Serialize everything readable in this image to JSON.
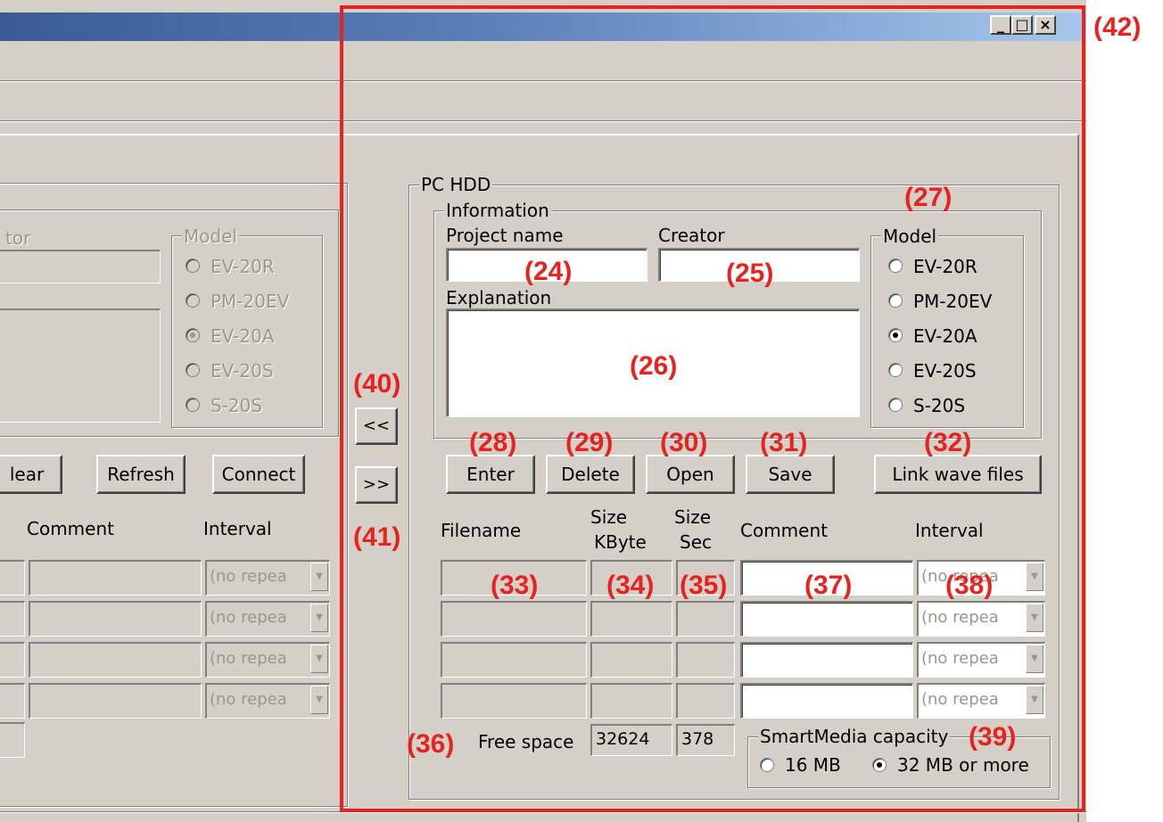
{
  "window_controls": {
    "minimize": "_",
    "maximize": "□",
    "close": "×"
  },
  "left_panel": {
    "creator_label_fragment": "tor",
    "model_legend": "Model",
    "models": [
      "EV-20R",
      "PM-20EV",
      "EV-20A",
      "EV-20S",
      "S-20S"
    ],
    "selected_model": "EV-20A",
    "buttons": {
      "clear": "lear",
      "refresh": "Refresh",
      "connect": "Connect"
    },
    "col_comment": "Comment",
    "col_interval": "Interval",
    "interval_value": "(no repea"
  },
  "transfer": {
    "copy_left": "<<",
    "copy_right": ">>"
  },
  "pc_hdd": {
    "legend": "PC HDD",
    "information_legend": "Information",
    "project_name_label": "Project name",
    "creator_label": "Creator",
    "explanation_label": "Explanation",
    "model_legend": "Model",
    "models": [
      "EV-20R",
      "PM-20EV",
      "EV-20A",
      "EV-20S",
      "S-20S"
    ],
    "selected_model": "EV-20A",
    "buttons": {
      "enter": "Enter",
      "delete": "Delete",
      "open": "Open",
      "save": "Save",
      "link": "Link wave files"
    },
    "columns": {
      "filename": "Filename",
      "size": "Size",
      "kbyte": "KByte",
      "size2": "Size",
      "sec": "Sec",
      "comment": "Comment",
      "interval": "Interval"
    },
    "interval_value": "(no repea",
    "free_space_label": "Free space",
    "free_space_kbyte": "32624",
    "free_space_sec": "378",
    "smartmedia_legend": "SmartMedia capacity",
    "capacity_options": [
      "16 MB",
      "32 MB or more"
    ],
    "selected_capacity": "32 MB or more"
  },
  "annotations": {
    "a24": "(24)",
    "a25": "(25)",
    "a26": "(26)",
    "a27": "(27)",
    "a28": "(28)",
    "a29": "(29)",
    "a30": "(30)",
    "a31": "(31)",
    "a32": "(32)",
    "a33": "(33)",
    "a34": "(34)",
    "a35": "(35)",
    "a36": "(36)",
    "a37": "(37)",
    "a38": "(38)",
    "a39": "(39)",
    "a40": "(40)",
    "a41": "(41)",
    "a42": "(42)"
  },
  "colors": {
    "annotation_red": "#e8221e",
    "window_face": "#d4d0c8",
    "title_start": "#3a5b96",
    "title_end": "#a6c8ec"
  }
}
